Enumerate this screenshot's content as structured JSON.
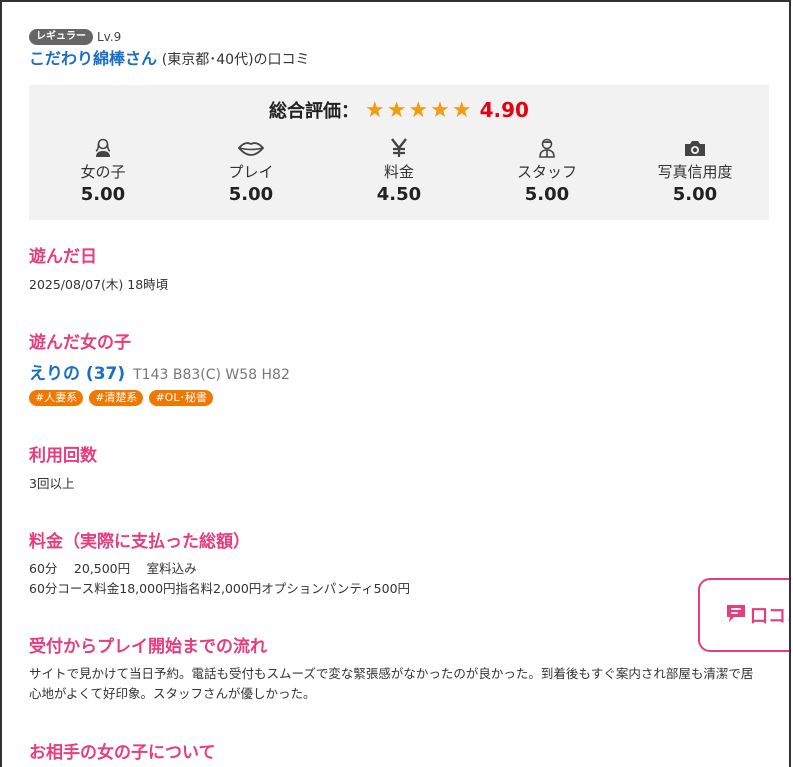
{
  "reviewer": {
    "rank_badge": "レギュラー",
    "level": "Lv.9",
    "name": "こだわり綿棒さん",
    "meta": "(東京都･40代)の口コミ"
  },
  "scores": {
    "total_label": "総合評価：",
    "stars_text": "★★★★★",
    "total_value": "4.90",
    "star_color": "#f39c12",
    "categories": [
      {
        "icon": "woman-icon",
        "label": "女の子",
        "value": "5.00"
      },
      {
        "icon": "lips-icon",
        "label": "プレイ",
        "value": "5.00"
      },
      {
        "icon": "yen-icon",
        "label": "料金",
        "value": "4.50"
      },
      {
        "icon": "staff-icon",
        "label": "スタッフ",
        "value": "5.00"
      },
      {
        "icon": "camera-icon",
        "label": "写真信用度",
        "value": "5.00"
      }
    ]
  },
  "sections": {
    "visit_date_title": "遊んだ日",
    "visit_date": "2025/08/07(木) 18時頃",
    "girl_title": "遊んだ女の子",
    "girl_name": "えりの (37)",
    "girl_size": "T143 B83(C) W58 H82",
    "girl_tags": [
      "#人妻系",
      "#清楚系",
      "#OL･秘書"
    ],
    "usage_title": "利用回数",
    "usage": "3回以上",
    "price_title": "料金（実際に支払った総額）",
    "price_line1": "60分　 20,500円　 室料込み",
    "price_line2": "60分コース料金18,000円指名料2,000円オプションパンティ500円",
    "flow_title": "受付からプレイ開始までの流れ",
    "flow_text": "サイトで見かけて当日予約。電話も受付もスムーズで変な緊張感がなかったのが良かった。到着後もすぐ案内され部屋も清潔で居心地がよくて好印象。スタッフさんが優しかった。",
    "about_girl_title": "お相手の女の子について"
  },
  "float_button": {
    "icon": "comment-icon",
    "label": "口コミ"
  },
  "colors": {
    "accent_pink": "#e73c7e",
    "link_blue": "#1a6fc4",
    "tag_orange": "#f07800",
    "score_red": "#e60012"
  }
}
